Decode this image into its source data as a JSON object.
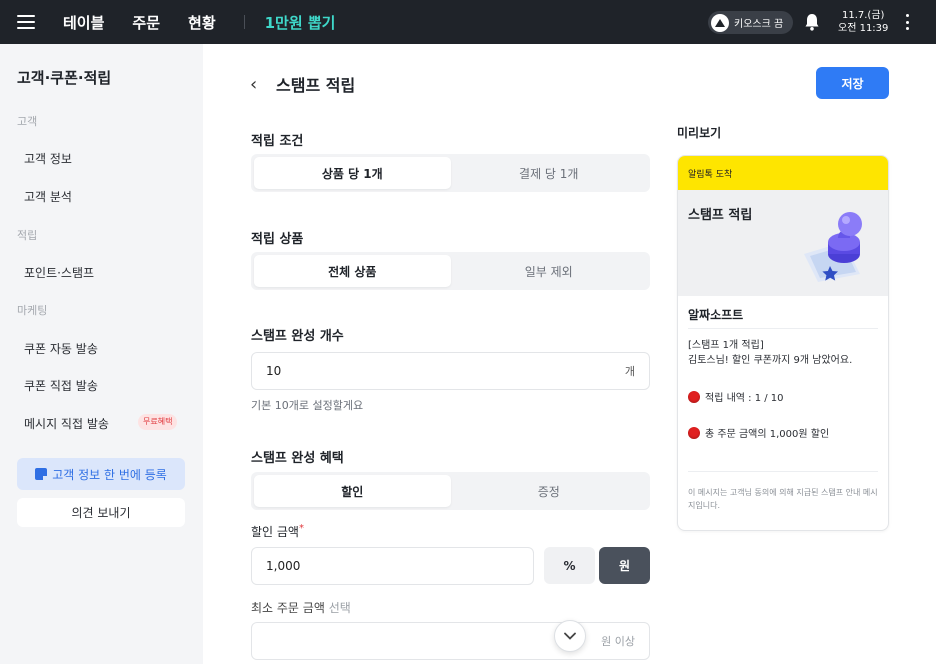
{
  "topbar": {
    "nav": [
      "테이블",
      "주문",
      "현황"
    ],
    "active_nav": "1만원 뽑기",
    "kiosk_label": "키오스크 끔",
    "clock_date": "11.7.(금)",
    "clock_time": "오전 11:39"
  },
  "sidebar": {
    "title": "고객·쿠폰·적립",
    "sections": {
      "customer": "고객",
      "points": "적립",
      "marketing": "마케팅"
    },
    "items": {
      "customer_info": "고객 정보",
      "customer_analysis": "고객 분석",
      "point_stamp": "포인트·스탬프",
      "coupon_auto": "쿠폰 자동 발송",
      "coupon_direct": "쿠폰 직접 발송",
      "message_direct": "메시지 직접 발송"
    },
    "badge_free": "무료혜택",
    "register_button": "고객 정보 한 번에 등록",
    "feedback_button": "의견 보내기"
  },
  "main": {
    "title": "스탬프 적립",
    "save_button": "저장",
    "condition": {
      "label": "적립 조건",
      "options": [
        "상품 당 1개",
        "결제 당 1개"
      ],
      "selected": "상품 당 1개"
    },
    "products": {
      "label": "적립 상품",
      "options": [
        "전체 상품",
        "일부 제외"
      ],
      "selected": "전체 상품"
    },
    "stamp_count": {
      "label": "스탬프 완성 개수",
      "value": "10",
      "unit": "개",
      "help": "기본 10개로 설정할게요"
    },
    "benefit": {
      "label": "스탬프 완성 혜택",
      "options": [
        "할인",
        "증정"
      ],
      "selected": "할인"
    },
    "discount": {
      "label": "할인 금액",
      "required_mark": "*",
      "value": "1,000",
      "units": [
        "%",
        "원"
      ],
      "selected_unit": "원"
    },
    "min_order": {
      "label": "최소 주문 금액",
      "optional_mark": "선택",
      "unit": "원 이상"
    }
  },
  "preview": {
    "title": "미리보기",
    "card_header": "알림톡 도착",
    "hero_title": "스탬프 적립",
    "brand": "알짜소프트",
    "message_line1": "[스탬프 1개 적립]",
    "message_line2": "김토스님! 할인 쿠폰까지 9개 남았어요.",
    "bullet1": "적립 내역 : 1 / 10",
    "bullet2": "총 주문 금액의 1,000원 할인",
    "footnote": "이 메시지는 고객님 동의에 의해 지급된 스탬프 안내 메시지입니다."
  },
  "colors": {
    "topbar_bg": "#1f2329",
    "active_nav": "#3fd8ca",
    "save_button": "#2f7bf5",
    "kakao_yellow": "#fee500",
    "unit_selected": "#4a515c"
  }
}
